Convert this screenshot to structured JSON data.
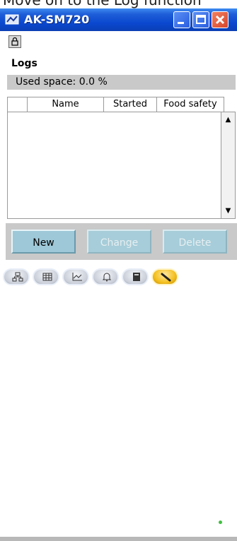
{
  "top_caption": "Move on to the Log function",
  "window": {
    "title": "AK-SM720",
    "minimize_label": "",
    "maximize_label": "",
    "close_label": ""
  },
  "page": {
    "heading": "Logs",
    "used_space": "Used space: 0.0 %"
  },
  "table": {
    "columns": [
      "",
      "Name",
      "Started",
      "Food safety"
    ],
    "rows": []
  },
  "buttons": {
    "new": "New",
    "change": "Change",
    "delete": "Delete"
  },
  "nav": {
    "items": [
      "network-icon",
      "grid-icon",
      "graph-icon",
      "bell-icon",
      "book-icon",
      "wrench-icon"
    ],
    "active": "wrench-icon"
  },
  "colors": {
    "titlebar": "#0a48cf",
    "panel_gray": "#c9c9c9",
    "button_teal": "#9ec8d8",
    "active_nav": "#f4c020",
    "status_led": "#3fbf3f"
  }
}
